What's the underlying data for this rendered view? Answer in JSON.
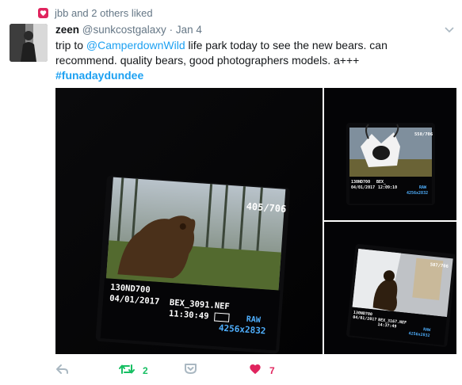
{
  "liked_by": "jbb and 2 others liked",
  "tweet": {
    "display_name": "zeen",
    "handle": "@sunkcostgalaxy",
    "separator": "·",
    "date": "Jan 4",
    "text_before": "trip to ",
    "mention": "@CamperdownWild",
    "text_after": " life park today to see the new bears. can recommend. quality bears, good photographers models. a+++",
    "hashtag": "#funadaydundee"
  },
  "photos": {
    "main": {
      "counter": "405/706",
      "folder": "130ND700",
      "filename": "BEX_3091.NEF",
      "date": "04/01/2017",
      "time": "11:30:49",
      "format": "RAW",
      "resolution": "4256x2832"
    },
    "top_right": {
      "counter": "550/706",
      "folder": "130ND700",
      "filename": "BEX_",
      "date": "04/01/2017",
      "time": "12:09:10",
      "format": "RAW",
      "resolution": "4256x2832"
    },
    "bottom_right": {
      "counter": "587/706",
      "folder": "130ND700",
      "filename": "BEX_3167.NEF",
      "date": "04/01/2017",
      "time": "14:37:49",
      "format": "RAW",
      "resolution": "4256x2832"
    }
  },
  "actions": {
    "reply_icon": "reply-icon",
    "retweet_icon": "retweet-icon",
    "retweet_count": "2",
    "dm_icon": "direct-message-icon",
    "like_icon": "heart-icon",
    "like_count": "7"
  },
  "colors": {
    "like": "#e0245e",
    "retweet": "#17bf63",
    "link": "#1da1f2",
    "muted": "#657786"
  }
}
